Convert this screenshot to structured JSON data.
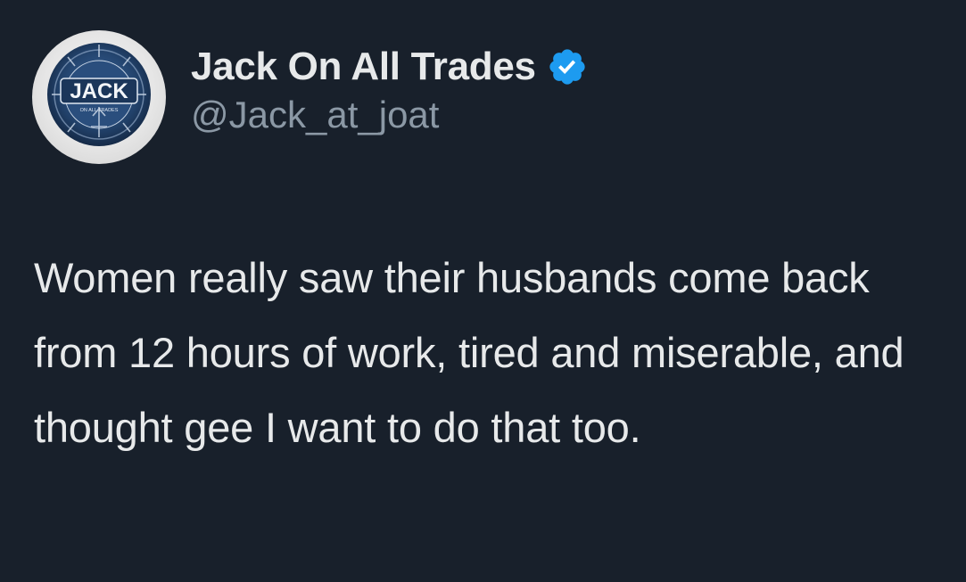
{
  "tweet": {
    "author": {
      "display_name": "Jack On All Trades",
      "handle": "@Jack_at_joat",
      "verified_icon": "verified-badge-icon",
      "avatar": {
        "logo_text": "JACK",
        "logo_subtext": "ON ALL TRADES"
      }
    },
    "text": "Women really saw their husbands come back from 12 hours of work, tired and miserable, and thought gee I want to do that too."
  },
  "colors": {
    "background": "#18202b",
    "primary_text": "#e7e9ea",
    "secondary_text": "#8b98a5",
    "verified_blue": "#1d9bf0",
    "avatar_ring": "#1f3e63"
  }
}
